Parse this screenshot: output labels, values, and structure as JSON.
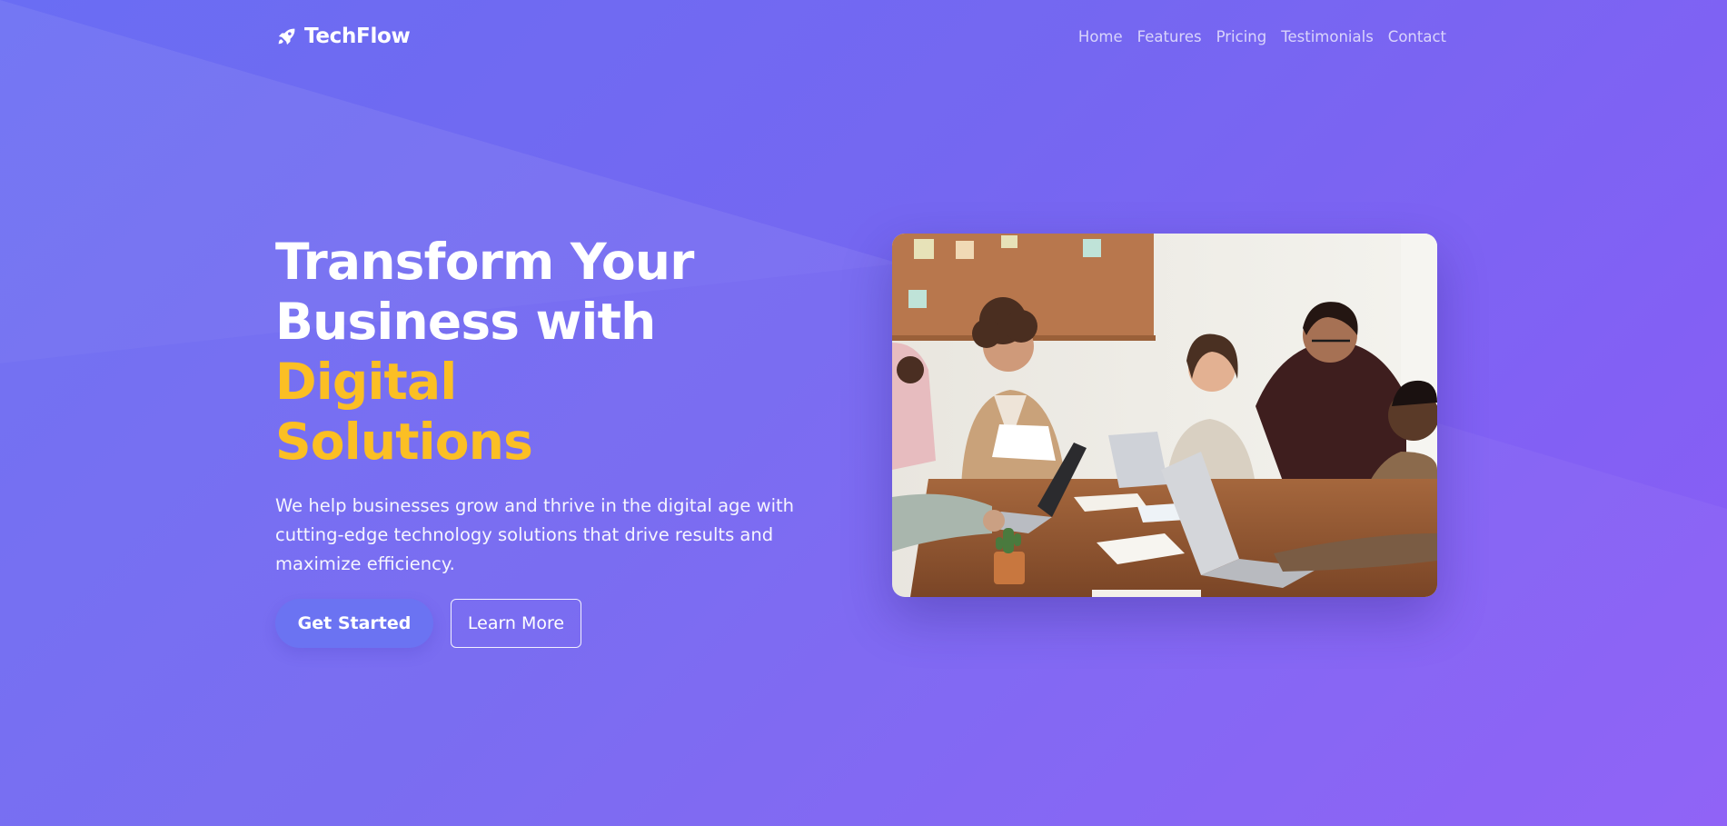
{
  "brand": {
    "name": "TechFlow",
    "icon": "rocket-icon"
  },
  "nav": {
    "items": [
      "Home",
      "Features",
      "Pricing",
      "Testimonials",
      "Contact"
    ]
  },
  "hero": {
    "title_line1": "Transform Your",
    "title_line2": "Business with ",
    "title_accent_line2": "Digital",
    "title_accent_line3": "Solutions",
    "description": "We help businesses grow and thrive in the digital age with cutting-edge technology solutions that drive results and maximize efficiency.",
    "primary_button": "Get Started",
    "secondary_button": "Learn More",
    "image": "team-meeting-photo"
  },
  "colors": {
    "background_start": "#6a6df3",
    "background_end": "#8b5cf6",
    "accent": "#fbbf24",
    "primary_button": "#6b73f2"
  }
}
